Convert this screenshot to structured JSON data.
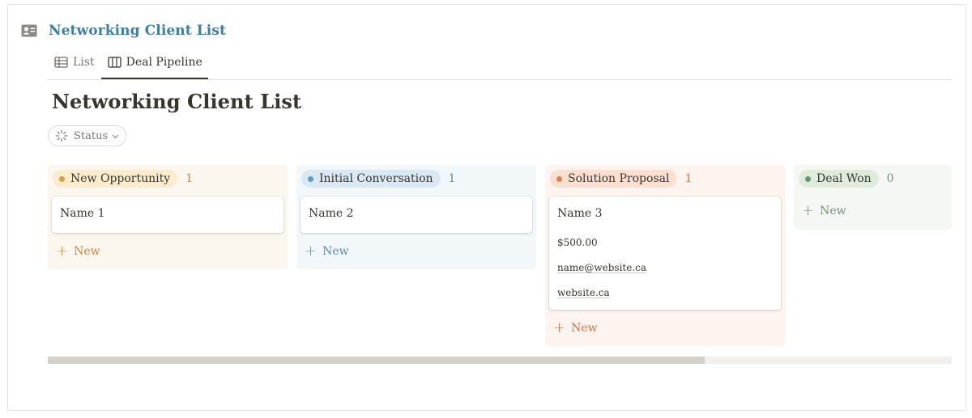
{
  "database": {
    "title": "Networking Client List",
    "icon": "contact-card-icon",
    "title_color": "#3c7fa3"
  },
  "tabs": [
    {
      "label": "List",
      "icon": "table-icon",
      "active": false
    },
    {
      "label": "Deal Pipeline",
      "icon": "board-columns-icon",
      "active": true
    }
  ],
  "page": {
    "title": "Networking Client List"
  },
  "filter": {
    "label": "Status",
    "icon": "status-spinner-icon"
  },
  "columns": [
    {
      "status": "New Opportunity",
      "count": "1",
      "bg": "#fbf6ee",
      "pill_bg": "#fbeccd",
      "dot": "#d9a33a",
      "accent": "#c08a3e",
      "cards": [
        {
          "name": "Name 1"
        }
      ],
      "new_label": "New"
    },
    {
      "status": "Initial Conversation",
      "count": "1",
      "bg": "#f2f7fa",
      "pill_bg": "#d9e8f3",
      "dot": "#5a9cc8",
      "accent": "#5e8eab",
      "cards": [
        {
          "name": "Name 2"
        }
      ],
      "new_label": "New"
    },
    {
      "status": "Solution Proposal",
      "count": "1",
      "bg": "#fdf3ef",
      "pill_bg": "#fbdfd1",
      "dot": "#e0804f",
      "accent": "#cf7547",
      "cards": [
        {
          "name": "Name 3",
          "amount": "$500.00",
          "email": "name@website.ca",
          "website": "website.ca"
        }
      ],
      "new_label": "New"
    },
    {
      "status": "Deal Won",
      "count": "0",
      "bg": "#f4f7f3",
      "pill_bg": "#dfecdc",
      "dot": "#5d9a69",
      "accent": "#6f9479",
      "cards": [],
      "new_label": "New"
    }
  ],
  "scrollbar": {
    "position": 0.73
  }
}
